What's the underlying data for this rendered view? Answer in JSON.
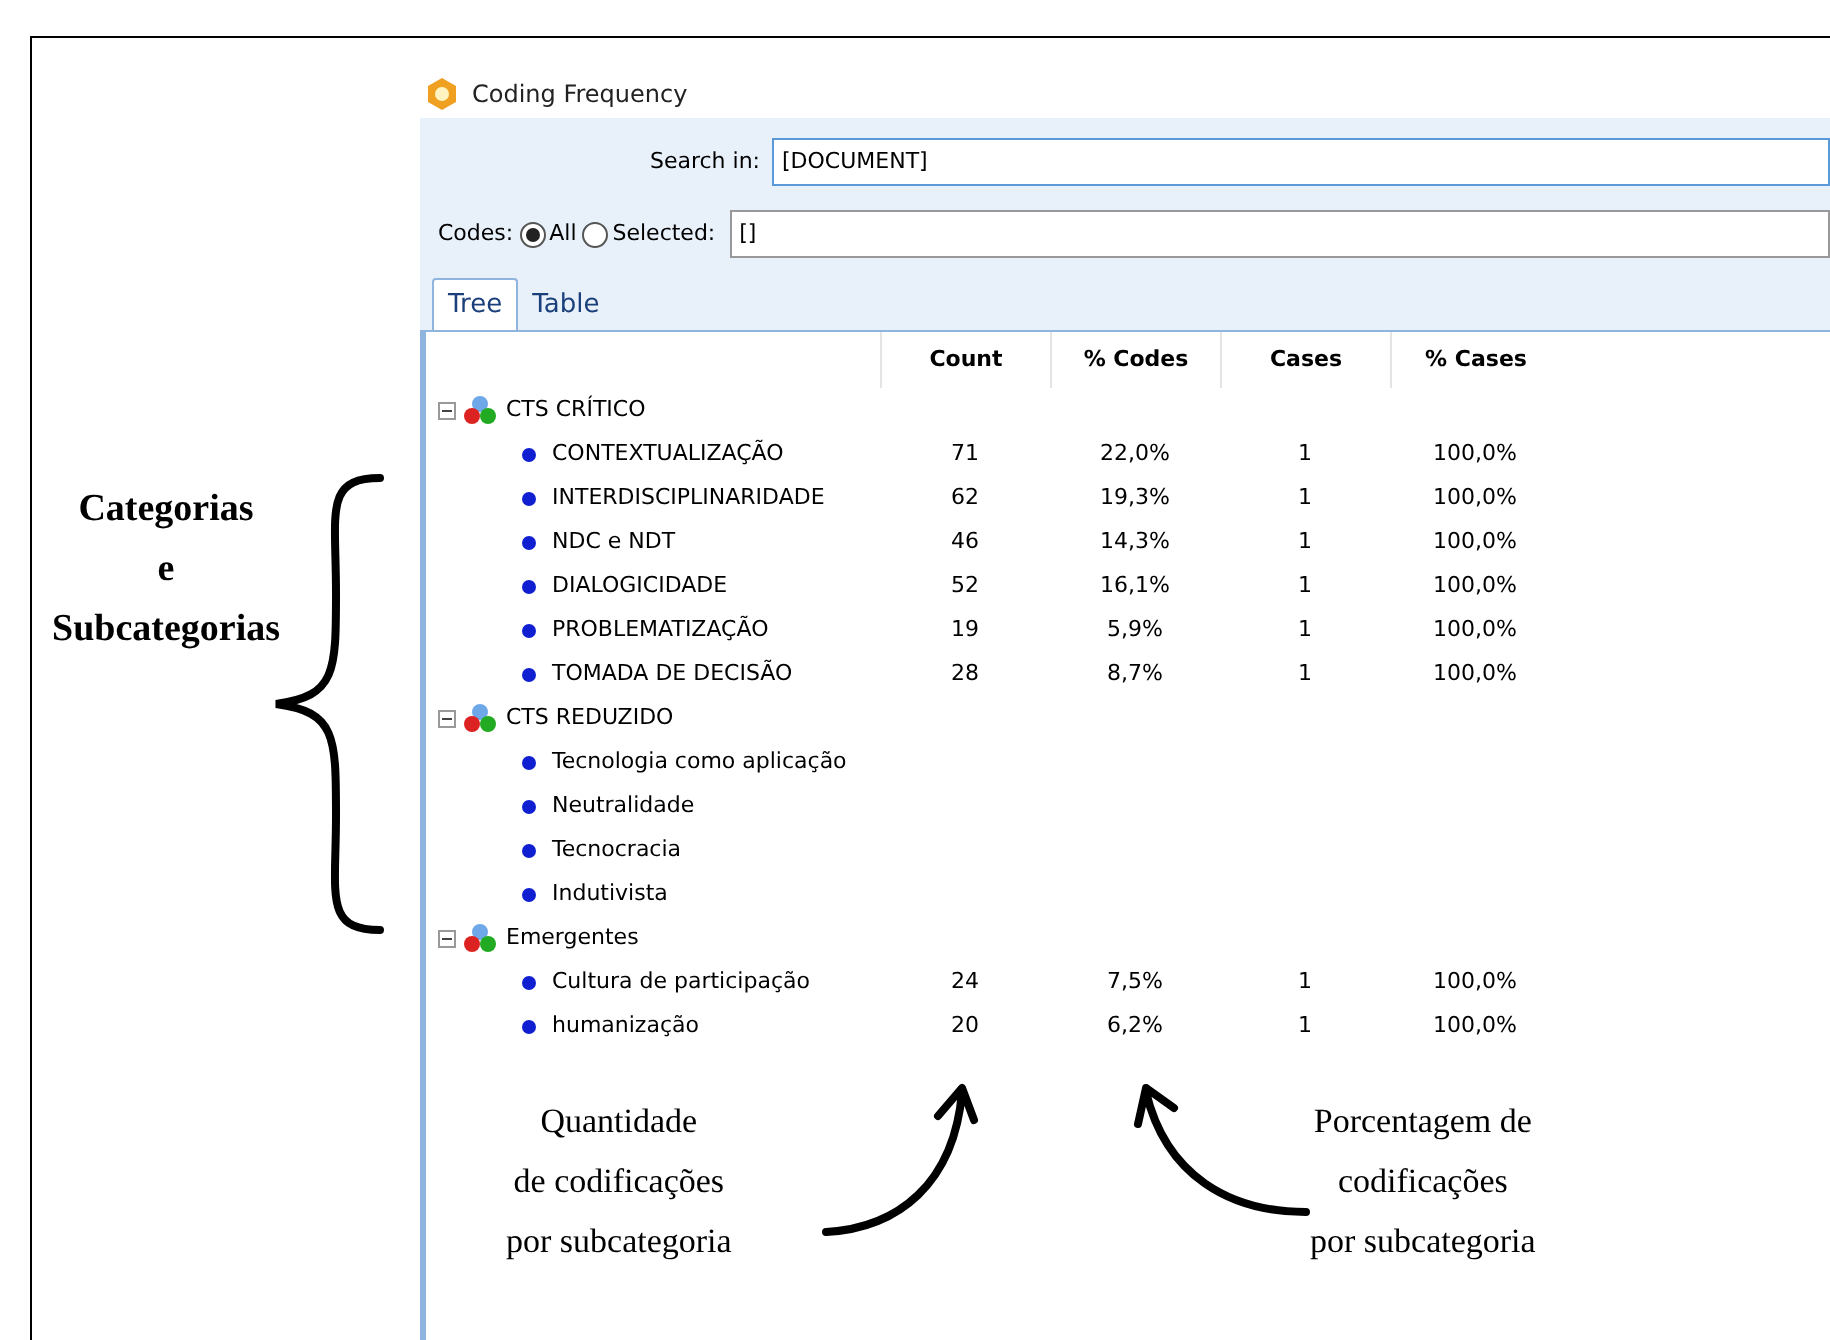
{
  "window": {
    "title": "Coding Frequency"
  },
  "search": {
    "label": "Search in:",
    "value": "[DOCUMENT]"
  },
  "codes": {
    "label": "Codes:",
    "options": [
      {
        "label": "All",
        "selected": true
      },
      {
        "label": "Selected:",
        "selected": false
      }
    ],
    "value": "[]"
  },
  "tabs": [
    {
      "label": "Tree",
      "selected": true
    },
    {
      "label": "Table",
      "selected": false
    }
  ],
  "table": {
    "columns": [
      "Count",
      "% Codes",
      "Cases",
      "% Cases"
    ],
    "rows": [
      {
        "name": "CTS CRÍTICO",
        "expanded": true,
        "children": [
          {
            "name": "CONTEXTUALIZAÇÃO",
            "cells": [
              "71",
              "22,0%",
              "1",
              "100,0%"
            ]
          },
          {
            "name": "INTERDISCIPLINARIDADE",
            "cells": [
              "62",
              "19,3%",
              "1",
              "100,0%"
            ]
          },
          {
            "name": "NDC e NDT",
            "cells": [
              "46",
              "14,3%",
              "1",
              "100,0%"
            ]
          },
          {
            "name": "DIALOGICIDADE",
            "cells": [
              "52",
              "16,1%",
              "1",
              "100,0%"
            ]
          },
          {
            "name": "PROBLEMATIZAÇÃO",
            "cells": [
              "19",
              "5,9%",
              "1",
              "100,0%"
            ]
          },
          {
            "name": "TOMADA DE DECISÃO",
            "cells": [
              "28",
              "8,7%",
              "1",
              "100,0%"
            ]
          }
        ]
      },
      {
        "name": "CTS REDUZIDO",
        "expanded": true,
        "children": [
          {
            "name": "Tecnologia como aplicação"
          },
          {
            "name": "Neutralidade"
          },
          {
            "name": "Tecnocracia"
          },
          {
            "name": "Indutivista"
          }
        ]
      },
      {
        "name": "Emergentes",
        "expanded": true,
        "children": [
          {
            "name": "Cultura de participação",
            "cells": [
              "24",
              "7,5%",
              "1",
              "100,0%"
            ]
          },
          {
            "name": "humanização",
            "cells": [
              "20",
              "6,2%",
              "1",
              "100,0%"
            ]
          }
        ]
      }
    ]
  },
  "annotations": {
    "left": [
      "Categorias",
      "e",
      "Subcategorias"
    ],
    "count_note": [
      "Quantidade",
      "de codificações",
      "por subcategoria"
    ],
    "percent_note": [
      "Porcentagem de",
      "codificações",
      "por subcategoria"
    ]
  }
}
